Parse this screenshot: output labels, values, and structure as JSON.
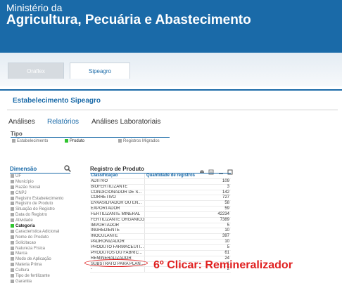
{
  "header": {
    "line1": "Ministério da",
    "line2": "Agricultura, Pecuária e Abastecimento"
  },
  "tabs": {
    "oraflex": "Oraflex",
    "sipeagro": "Sipeagro"
  },
  "section_title": "Estabelecimento Sipeagro",
  "nav": {
    "analises": "Análises",
    "relatorios": "Relatórios",
    "laboratoriais": "Análises Laboratoriais"
  },
  "tipo": {
    "label": "Tipo",
    "options": [
      "Estabelecimento",
      "Produto",
      "Registros Migrados"
    ],
    "selected": "Produto"
  },
  "dimensao": {
    "label": "Dimensão",
    "items": [
      "UF",
      "Município",
      "Razão Social",
      "CNPJ",
      "Registro Estabelecimento",
      "Registro de Produto",
      "Situação do Registro",
      "Data do Registro",
      "Atividade",
      "Categoria",
      "Caracteristica Adicional",
      "Nome do Produto",
      "Solicitacao",
      "Natureza Física",
      "Marca",
      "Modo de Aplicação",
      "Materia Prima",
      "Cultura",
      "Tipo de fertilizante",
      "Garantia"
    ],
    "selected": "Categoria"
  },
  "registro": {
    "title": "Registro de Produto",
    "columns": [
      "Classificação",
      "Quantidade de registros"
    ],
    "rows": [
      [
        "ADITIVO",
        "109"
      ],
      [
        "BIOFERTILIZANTE",
        "3"
      ],
      [
        "CONDICIONADOR DE S...",
        "142"
      ],
      [
        "CORRETIVO",
        "727"
      ],
      [
        "ENVASILHADOR OU EN...",
        "58"
      ],
      [
        "EXPORTADOR",
        "59"
      ],
      [
        "FERTILIZANTE MINERAL",
        "42234"
      ],
      [
        "FERTILIZANTE ORGÂNICO",
        "7389"
      ],
      [
        "IMPORTADOR",
        "5"
      ],
      [
        "INGREDIENTE",
        "10"
      ],
      [
        "INOCULANTE",
        "397"
      ],
      [
        "PADRONIZADOR",
        "10"
      ],
      [
        "PRODUTO FARMACÊUTI...",
        "5"
      ],
      [
        "PRODUTOS OU FABRIC...",
        "61"
      ],
      [
        "REMINERALIZADOR",
        "24"
      ],
      [
        "SUBSTRATO PARA PLAN...",
        "1"
      ],
      [
        "-",
        "2"
      ]
    ]
  },
  "callout": "6º Clicar: Remineralizador",
  "colors": {
    "header_blue": "#1a6aa8",
    "active_green": "#2fc42f",
    "callout_red": "#e02020"
  }
}
